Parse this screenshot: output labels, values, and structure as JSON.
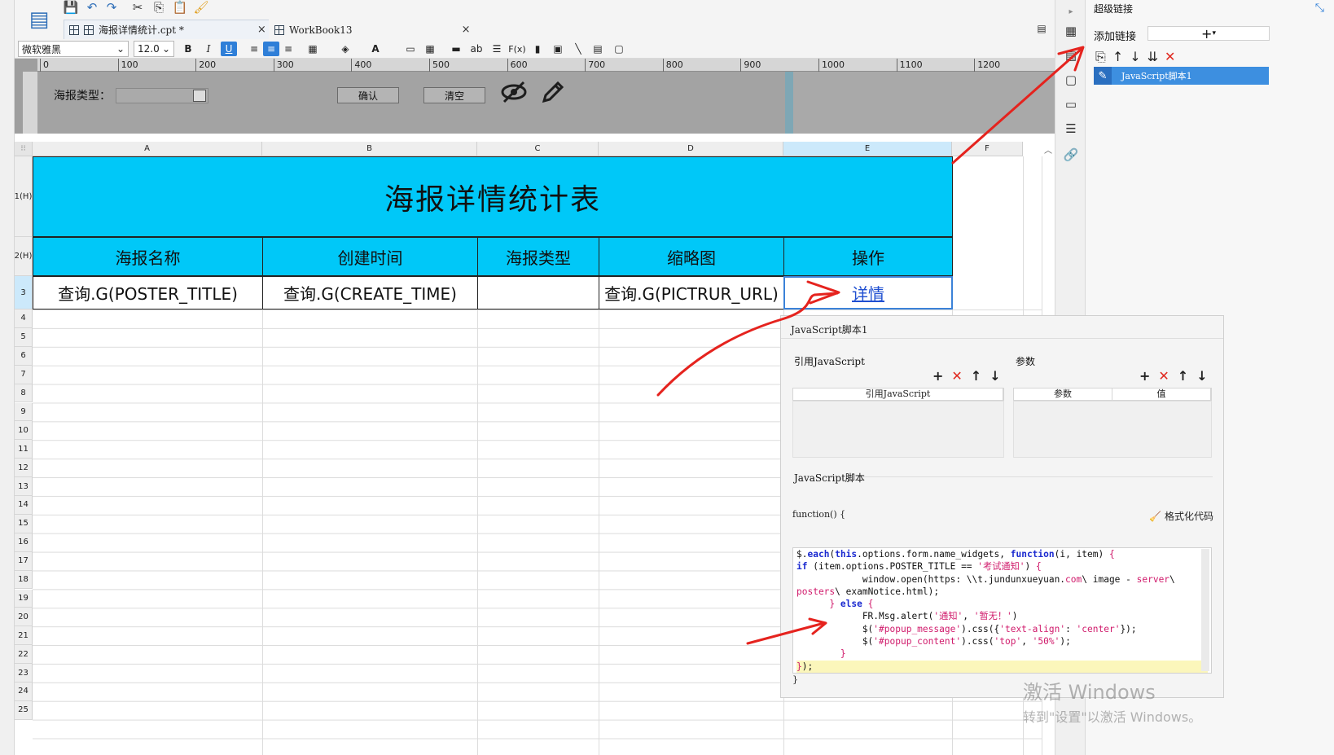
{
  "tabs": [
    {
      "label": "海报详情统计.cpt *",
      "close": "×",
      "active": true
    },
    {
      "label": "WorkBook13",
      "close": "×",
      "active": false
    }
  ],
  "format_bar": {
    "font": "微软雅黑",
    "size": "12.0",
    "bold": "B",
    "italic": "I",
    "underline": "U"
  },
  "ruler_ticks": [
    "0",
    "100",
    "200",
    "300",
    "400",
    "500",
    "600",
    "700",
    "800",
    "900",
    "1000",
    "1100",
    "1200"
  ],
  "param_panel": {
    "label": "海报类型：",
    "confirm": "确认",
    "clear": "清空"
  },
  "columns": [
    "A",
    "B",
    "C",
    "D",
    "E",
    "F"
  ],
  "rows": [
    "1(H)",
    "2(H)",
    "3",
    "4",
    "5",
    "6",
    "7",
    "8",
    "9",
    "10",
    "11",
    "12",
    "13",
    "14",
    "15",
    "16",
    "17",
    "18",
    "19",
    "20",
    "21",
    "22",
    "23",
    "24",
    "25"
  ],
  "report": {
    "title": "海报详情统计表",
    "headers": [
      "海报名称",
      "创建时间",
      "海报类型",
      "缩略图",
      "操作"
    ],
    "row3": [
      "查询.G(POSTER_TITLE)",
      "查询.G(CREATE_TIME)",
      "",
      "查询.G(PICTRUR_URL)",
      "详情"
    ]
  },
  "hyperlink_panel": {
    "title": "超级链接",
    "add_label": "添加链接",
    "add_icon": "+",
    "item": "JavaScript脚本1"
  },
  "js_panel": {
    "title": "JavaScript脚本1",
    "ref_label": "引用JavaScript",
    "param_label": "参数",
    "ref_col": "引用JavaScript",
    "param_col": "参数",
    "value_col": "值",
    "script_label": "JavaScript脚本",
    "fn_open": "function() {",
    "fn_close": "}",
    "format_btn": "格式化代码"
  },
  "watermark": {
    "line1": "激活 Windows",
    "line2": "转到\"设置\"以激活 Windows。"
  },
  "colors": {
    "title_fill": "#00c8f8",
    "link": "#1f4fd1",
    "annotation": "#e5231e",
    "selection": "#3d8fe0"
  }
}
